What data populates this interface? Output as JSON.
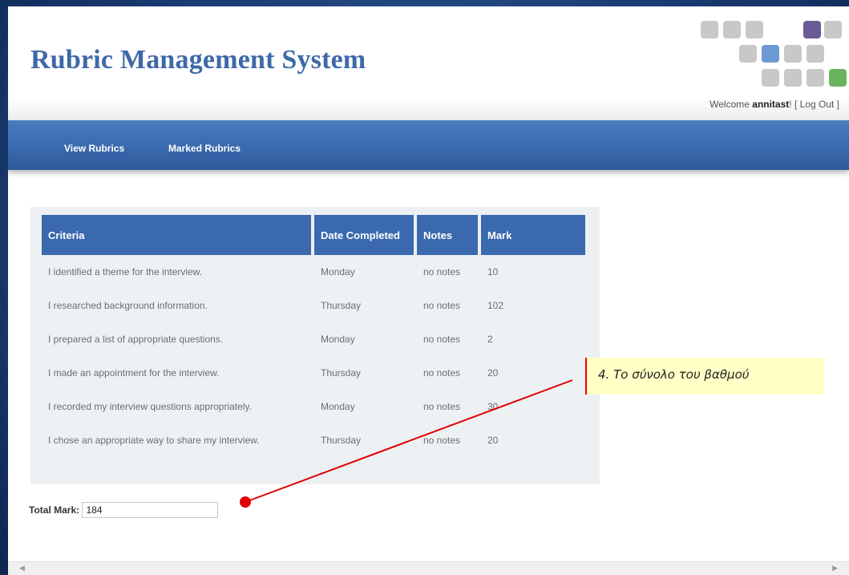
{
  "header": {
    "title": "Rubric Management System",
    "welcome_prefix": "Welcome ",
    "username": "annitast",
    "welcome_suffix": "! [ ",
    "logout_label": "Log Out",
    "welcome_end": " ]"
  },
  "logo": {
    "squares": [
      {
        "color": "#c8c8c8"
      },
      {
        "color": "#c8c8c8"
      },
      {
        "color": "#c8c8c8"
      },
      {
        "color": "#6a5a96"
      },
      {
        "color": "#c8c8c8"
      },
      {
        "color": "#c8c8c8"
      },
      {
        "color": "#6c98d4"
      },
      {
        "color": "#c8c8c8"
      },
      {
        "color": "#c8c8c8"
      },
      {
        "color": "#c8c8c8"
      },
      {
        "color": "#c8c8c8"
      },
      {
        "color": "#c8c8c8"
      },
      {
        "color": "#6ab45e"
      }
    ]
  },
  "nav": {
    "items": [
      {
        "label": "View Rubrics"
      },
      {
        "label": "Marked Rubrics"
      }
    ]
  },
  "table": {
    "headers": [
      "Criteria",
      "Date Completed",
      "Notes",
      "Mark"
    ],
    "rows": [
      {
        "criteria": "I identified a theme for the interview.",
        "date": "Monday",
        "notes": "no notes",
        "mark": "10"
      },
      {
        "criteria": "I researched background information.",
        "date": "Thursday",
        "notes": "no notes",
        "mark": "102"
      },
      {
        "criteria": "I prepared a list of appropriate questions.",
        "date": "Monday",
        "notes": "no notes",
        "mark": "2"
      },
      {
        "criteria": "I made an appointment for the interview.",
        "date": "Thursday",
        "notes": "no notes",
        "mark": "20"
      },
      {
        "criteria": "I recorded my interview questions appropriately.",
        "date": "Monday",
        "notes": "no notes",
        "mark": "30"
      },
      {
        "criteria": "I chose an appropriate way to share my interview.",
        "date": "Thursday",
        "notes": "no notes",
        "mark": "20"
      }
    ]
  },
  "total": {
    "label": "Total Mark:",
    "value": "184"
  },
  "annotation": {
    "text": "4. Το σύνολο του βαθμού"
  },
  "colors": {
    "brand_blue": "#3a69ad",
    "title_blue": "#3d69a8",
    "annotation_red": "#e00000",
    "annotation_bg": "#ffffc6"
  }
}
